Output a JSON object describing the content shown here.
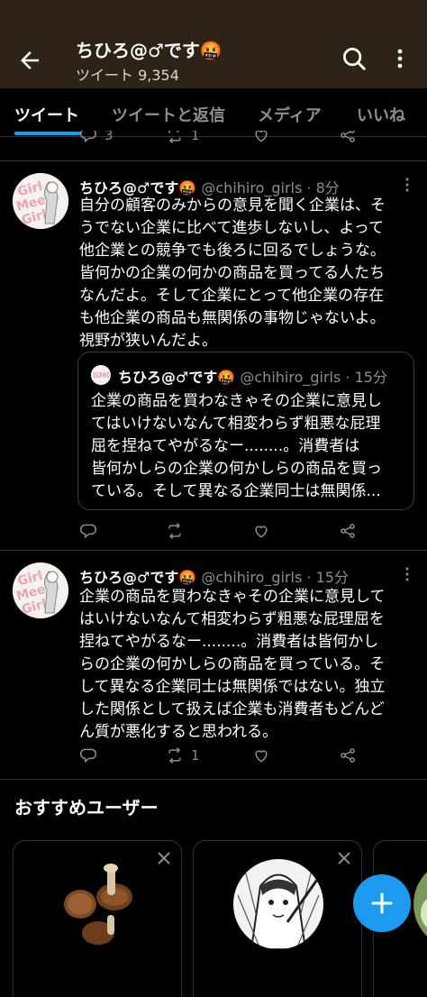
{
  "header": {
    "title": "ちひろ@♂です🤬",
    "subtitle": "ツイート 9,354"
  },
  "tabs": [
    {
      "label": "ツイート",
      "active": true
    },
    {
      "label": "ツイートと返信",
      "active": false
    },
    {
      "label": "メディア",
      "active": false
    },
    {
      "label": "いいね",
      "active": false
    }
  ],
  "top_actions": {
    "reply_count": "3",
    "retweet_count": "1"
  },
  "tweets": [
    {
      "name": "ちひろ@♂です🤬",
      "handle": "@chihiro_girls",
      "time": "8分",
      "lines": [
        "自分の顧客のみからの意見を聞く企業は、そ",
        "うでない企業に比べて進歩しないし、よって",
        "他企業との競争でも後ろに回るでしょうな。",
        "皆何かの企業の何かの商品を買ってる人たち",
        "なんだよ。そして企業にとって他企業の存在",
        "も他企業の商品も無関係の事物じゃないよ。",
        "視野が狭いんだよ。"
      ],
      "quote": {
        "name": "ちひろ@♂です🤬",
        "handle": "@chihiro_girls",
        "time": "15分",
        "lines": [
          "企業の商品を買わなきゃその企業に意見し",
          "てはいけないなんて相変わらず粗悪な屁理",
          "屈を捏ねてやがるなー........。消費者は",
          "皆何かしらの企業の何かしらの商品を買っ",
          "ている。そして異なる企業同士は無関係..."
        ]
      },
      "reply_count": "",
      "retweet_count": ""
    },
    {
      "name": "ちひろ@♂です🤬",
      "handle": "@chihiro_girls",
      "time": "15分",
      "lines": [
        "企業の商品を買わなきゃその企業に意見して",
        "はいけないなんて相変わらず粗悪な屁理屈を",
        "捏ねてやがるなー........。消費者は皆何かし",
        "らの企業の何かしらの商品を買っている。そ",
        "して異なる企業同士は無関係ではない。独立",
        "した関係として扱えば企業も消費者もどんど",
        "ん質が悪化すると思われる。"
      ],
      "reply_count": "",
      "retweet_count": "1"
    }
  ],
  "recommend": {
    "title": "おすすめユーザー"
  },
  "colors": {
    "accent": "#1d9bf0",
    "header_bg": "#2d2417",
    "muted": "#8b8f94"
  },
  "icons": [
    "back-arrow-icon",
    "search-icon",
    "more-vertical-icon",
    "reply-icon",
    "retweet-icon",
    "like-icon",
    "share-icon",
    "close-icon",
    "compose-plus-icon"
  ]
}
